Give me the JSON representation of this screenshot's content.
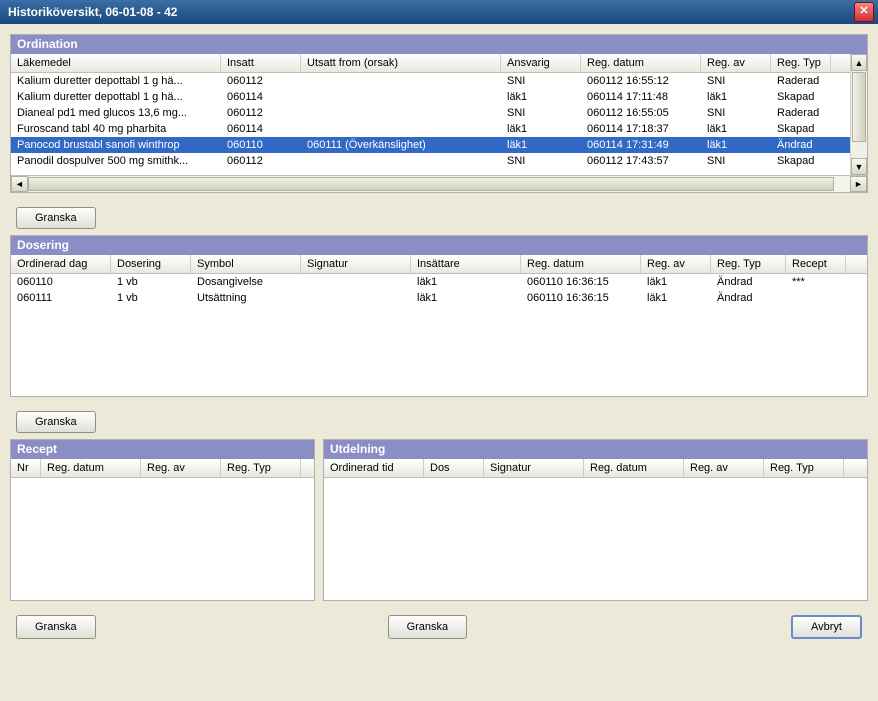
{
  "title": "Historiköversikt, 06-01-08 -       42",
  "close_icon": "✕",
  "ordination": {
    "header": "Ordination",
    "columns": {
      "lakemedel": "Läkemedel",
      "insatt": "Insatt",
      "utsatt": "Utsatt from (orsak)",
      "ansvarig": "Ansvarig",
      "reg_datum": "Reg. datum",
      "reg_av": "Reg. av",
      "reg_typ": "Reg. Typ"
    },
    "rows": [
      {
        "lakemedel": "Kalium duretter depottabl 1 g hä...",
        "insatt": "060112",
        "utsatt": "",
        "ansvarig": "SNI",
        "reg_datum": "060112 16:55:12",
        "reg_av": "SNI",
        "reg_typ": "Raderad",
        "selected": false
      },
      {
        "lakemedel": "Kalium duretter depottabl 1 g hä...",
        "insatt": "060114",
        "utsatt": "",
        "ansvarig": "läk1",
        "reg_datum": "060114 17:11:48",
        "reg_av": "läk1",
        "reg_typ": "Skapad",
        "selected": false
      },
      {
        "lakemedel": "Dianeal pd1 med glucos 13,6 mg...",
        "insatt": "060112",
        "utsatt": "",
        "ansvarig": "SNI",
        "reg_datum": "060112 16:55:05",
        "reg_av": "SNI",
        "reg_typ": "Raderad",
        "selected": false
      },
      {
        "lakemedel": "Furoscand tabl 40 mg pharbita",
        "insatt": "060114",
        "utsatt": "",
        "ansvarig": "läk1",
        "reg_datum": "060114 17:18:37",
        "reg_av": "läk1",
        "reg_typ": "Skapad",
        "selected": false
      },
      {
        "lakemedel": "Panocod brustabl sanofi winthrop",
        "insatt": "060110",
        "utsatt": "060111 (Överkänslighet)",
        "ansvarig": "läk1",
        "reg_datum": "060114 17:31:49",
        "reg_av": "läk1",
        "reg_typ": "Ändrad",
        "selected": true
      },
      {
        "lakemedel": "Panodil dospulver 500 mg smithk...",
        "insatt": "060112",
        "utsatt": "",
        "ansvarig": "SNI",
        "reg_datum": "060112 17:43:57",
        "reg_av": "SNI",
        "reg_typ": "Skapad",
        "selected": false
      }
    ],
    "btn": "Granska"
  },
  "dosering": {
    "header": "Dosering",
    "columns": {
      "ordinerad_dag": "Ordinerad dag",
      "dosering": "Dosering",
      "symbol": "Symbol",
      "signatur": "Signatur",
      "insattare": "Insättare",
      "reg_datum": "Reg. datum",
      "reg_av": "Reg. av",
      "reg_typ": "Reg. Typ",
      "recept": "Recept"
    },
    "rows": [
      {
        "ordinerad_dag": "060110",
        "dosering": "1 vb",
        "symbol": "Dosangivelse",
        "signatur": "",
        "insattare": "läk1",
        "reg_datum": "060110 16:36:15",
        "reg_av": "läk1",
        "reg_typ": "Ändrad",
        "recept": "***"
      },
      {
        "ordinerad_dag": "060111",
        "dosering": "1 vb",
        "symbol": "Utsättning",
        "signatur": "",
        "insattare": "läk1",
        "reg_datum": "060110 16:36:15",
        "reg_av": "läk1",
        "reg_typ": "Ändrad",
        "recept": ""
      }
    ],
    "btn": "Granska"
  },
  "recept": {
    "header": "Recept",
    "columns": {
      "nr": "Nr",
      "reg_datum": "Reg. datum",
      "reg_av": "Reg. av",
      "reg_typ": "Reg. Typ"
    },
    "btn": "Granska"
  },
  "utdelning": {
    "header": "Utdelning",
    "columns": {
      "ordinerad_tid": "Ordinerad tid",
      "dos": "Dos",
      "signatur": "Signatur",
      "reg_datum": "Reg. datum",
      "reg_av": "Reg. av",
      "reg_typ": "Reg. Typ"
    },
    "btn": "Granska"
  },
  "cancel_btn": "Avbryt",
  "scroll": {
    "left": "◄",
    "right": "►",
    "up": "▲",
    "down": "▼"
  }
}
